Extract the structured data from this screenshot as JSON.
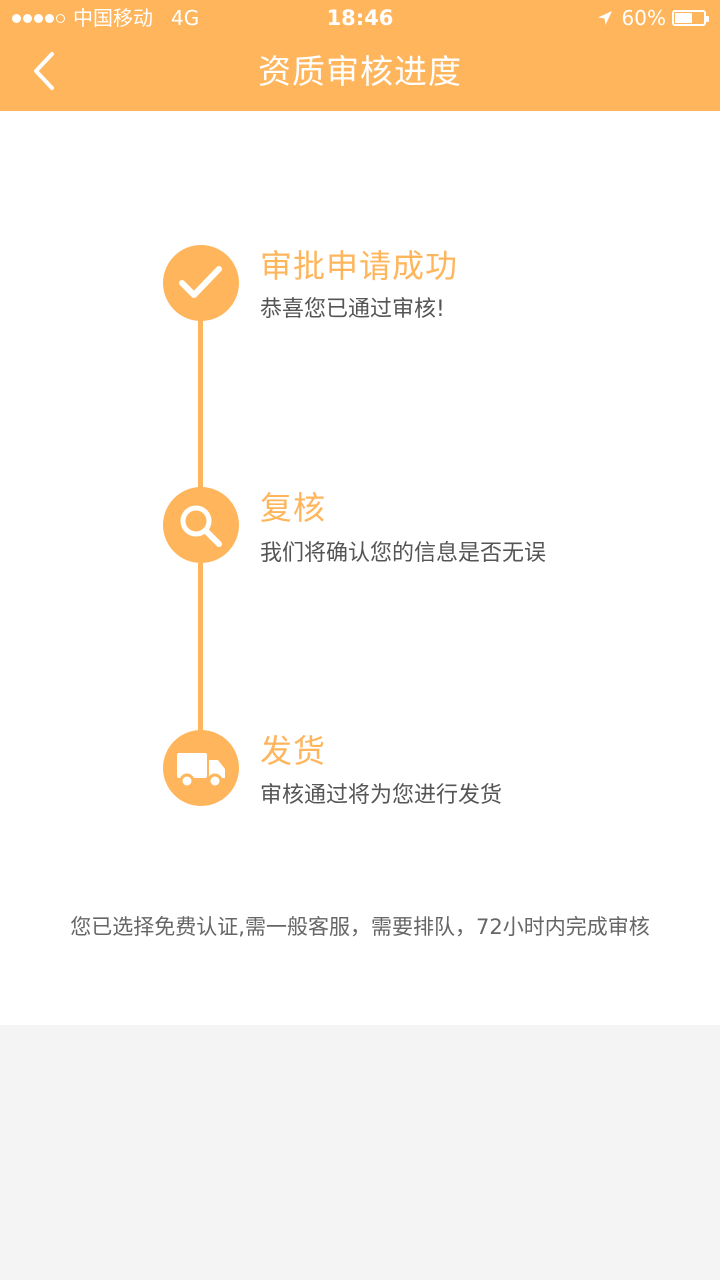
{
  "status_bar": {
    "carrier": "中国移动",
    "network": "4G",
    "time": "18:46",
    "battery_text": "60%",
    "battery_level": 0.6,
    "signal_filled": 4,
    "signal_total": 5,
    "location_icon": "location-arrow-icon"
  },
  "nav": {
    "back_icon": "chevron-left-icon",
    "title": "资质审核进度"
  },
  "steps": [
    {
      "icon": "checkmark-icon",
      "title": "审批申请成功",
      "description": "恭喜您已通过审核!"
    },
    {
      "icon": "search-icon",
      "title": "复核",
      "description": "我们将确认您的信息是否无误"
    },
    {
      "icon": "delivery-truck-icon",
      "title": "发货",
      "description": "审核通过将为您进行发货"
    }
  ],
  "footer_note": "您已选择免费认证,需一般客服，需要排队，72小时内完成审核",
  "colors": {
    "accent": "#ffb55c",
    "text_primary": "#555555",
    "text_secondary": "#666666",
    "page_background": "#f4f4f4",
    "content_background": "#ffffff"
  }
}
